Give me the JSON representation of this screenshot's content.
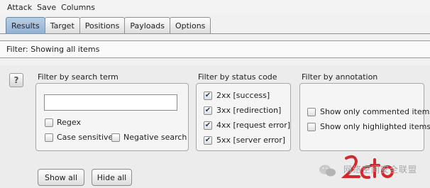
{
  "menu": [
    "Attack",
    "Save",
    "Columns"
  ],
  "tabs": [
    "Results",
    "Target",
    "Positions",
    "Payloads",
    "Options"
  ],
  "filter_bar": {
    "text": "Filter: Showing all items"
  },
  "help_label": "?",
  "search_group": {
    "title": "Filter by search term",
    "input_value": "",
    "regex": {
      "label": "Regex",
      "checked": false
    },
    "case_sensitive": {
      "label": "Case sensitive",
      "checked": false
    },
    "negative_search": {
      "label": "Negative search",
      "checked": false
    }
  },
  "status_group": {
    "title": "Filter by status code",
    "items": [
      {
        "label": "2xx  [success]",
        "checked": true
      },
      {
        "label": "3xx  [redirection]",
        "checked": true
      },
      {
        "label": "4xx  [request error]",
        "checked": true
      },
      {
        "label": "5xx  [server error]",
        "checked": true
      }
    ]
  },
  "annotation_group": {
    "title": "Filter by annotation",
    "items": [
      {
        "label": "Show only commented items",
        "checked": false
      },
      {
        "label": "Show only highlighted items",
        "checked": false
      }
    ]
  },
  "buttons": {
    "show_all": "Show all",
    "hide_all": "Hide all"
  },
  "watermark": {
    "text": "网络空间安全联盟"
  },
  "colors": {
    "active_tab": "#9db8d8",
    "watermark_red": "#d2282e"
  }
}
